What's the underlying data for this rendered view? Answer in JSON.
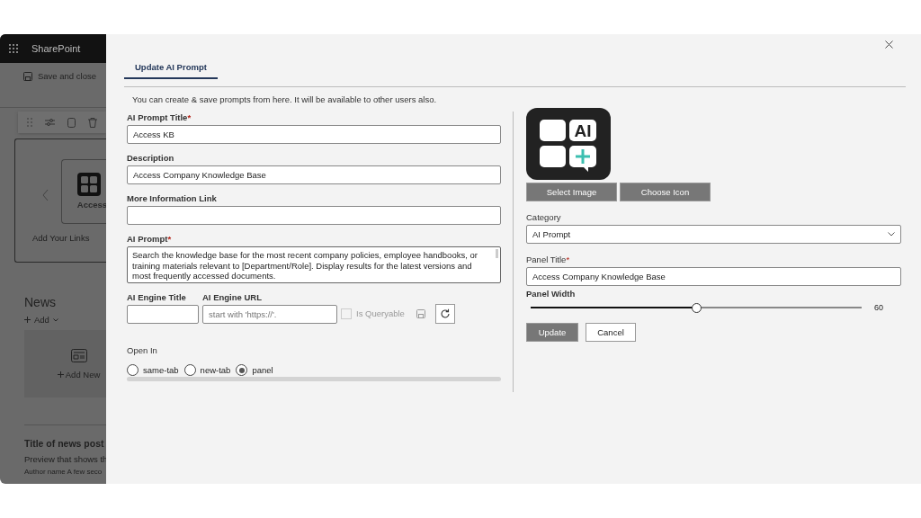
{
  "background_page": {
    "app_name": "SharePoint",
    "save_and_close": "Save and close",
    "link_tile": "Access",
    "add_links": "Add Your Links",
    "news_heading": "News",
    "add_menu": "Add",
    "add_news": "Add New",
    "news_title": "Title of news post",
    "news_preview": "Preview that shows th",
    "author": "Author name",
    "time": "A few seco"
  },
  "dialog": {
    "tabs": [
      {
        "label": "Update AI Prompt",
        "selected": true
      }
    ],
    "intro": "You can create & save prompts from here. It will be available to other users also.",
    "fields": [
      {
        "label": "AI Prompt Title",
        "required_mark": "*",
        "value": "Access KB"
      },
      {
        "label": "Description",
        "value": "Access Company Knowledge Base"
      },
      {
        "label": "More Information Link"
      }
    ],
    "prompt": {
      "label": "AI Prompt",
      "required_mark": "*",
      "value": "Search the knowledge base for the most recent company policies, employee handbooks, or training materials relevant to [Department/Role]. Display results for the latest versions and most frequently accessed documents."
    },
    "engine": {
      "title_label": "AI Engine Title",
      "url_label": "AI Engine URL",
      "url_placeholder": "start with 'https://'.",
      "queryable": {
        "label": "Is Queryable",
        "checked": false,
        "disabled": true
      }
    },
    "open_in": {
      "label": "Open In",
      "options": [
        {
          "label": "same-tab",
          "selected": false
        },
        {
          "label": "new-tab",
          "selected": false
        },
        {
          "label": "panel",
          "selected": true
        }
      ]
    },
    "logo_text": "AI",
    "image_buttons": [
      "Select Image",
      "Choose Icon"
    ],
    "category": {
      "label": "Category",
      "value": "AI Prompt"
    },
    "panel_title": {
      "label": "Panel Title",
      "required_mark": "*",
      "value": "Access Company Knowledge Base"
    },
    "panel_width": {
      "label": "Panel Width",
      "level": 0.5,
      "reading": "60"
    },
    "buttons": [
      {
        "label": "Update",
        "kind": "primary"
      },
      {
        "label": "Cancel",
        "kind": "secondary"
      }
    ]
  }
}
